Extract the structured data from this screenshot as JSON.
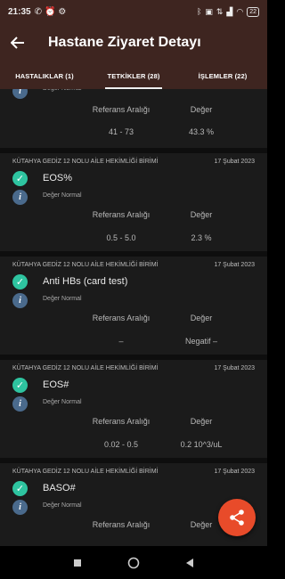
{
  "status_bar": {
    "time": "21:35",
    "left_icons": [
      "whatsapp-icon",
      "alarm-icon",
      "gear-icon"
    ],
    "right_icons": [
      "bluetooth-icon",
      "sim-icon",
      "data-icon",
      "signal-icon",
      "wifi-icon"
    ],
    "battery": "22"
  },
  "appbar": {
    "title": "Hastane Ziyaret Detayı"
  },
  "tabs": [
    {
      "label": "HASTALIKLAR (1)"
    },
    {
      "label": "TETKİKLER (28)"
    },
    {
      "label": "İŞLEMLER (22)"
    }
  ],
  "labels": {
    "ref_range": "Referans Aralığı",
    "value": "Değer",
    "normal": "Değer Normal"
  },
  "partial_card": {
    "ref_range": "41 - 73",
    "value": "43.3 %"
  },
  "cards": [
    {
      "facility": "KÜTAHYA GEDİZ 12 NOLU AİLE HEKİMLİĞİ BİRİMİ",
      "date": "17 Şubat 2023",
      "test": "EOS%",
      "ref_range": "0.5 - 5.0",
      "value": "2.3 %"
    },
    {
      "facility": "KÜTAHYA GEDİZ 12 NOLU AİLE HEKİMLİĞİ BİRİMİ",
      "date": "17 Şubat 2023",
      "test": "Anti HBs (card test)",
      "ref_range": "–",
      "value": "Negatif –"
    },
    {
      "facility": "KÜTAHYA GEDİZ 12 NOLU AİLE HEKİMLİĞİ BİRİMİ",
      "date": "17 Şubat 2023",
      "test": "EOS#",
      "ref_range": "0.02 - 0.5",
      "value": "0.2 10^3/uL"
    },
    {
      "facility": "KÜTAHYA GEDİZ 12 NOLU AİLE HEKİMLİĞİ BİRİMİ",
      "date": "17 Şubat 2023",
      "test": "BASO#",
      "ref_range": "",
      "value": ""
    }
  ],
  "fab": {
    "icon": "share-icon"
  },
  "navbar": {
    "buttons": [
      "recents-square-icon",
      "home-circle-icon",
      "back-triangle-icon"
    ]
  }
}
